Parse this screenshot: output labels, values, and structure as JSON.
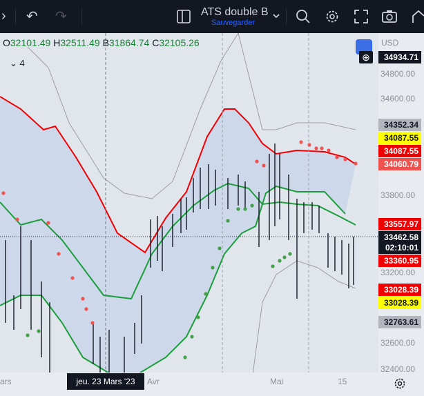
{
  "toolbar": {
    "title": "ATS double B",
    "subtitle": "Sauvegarder",
    "icons": [
      "chevron-icon",
      "undo-icon",
      "redo-icon",
      "layout-icon",
      "chevron-down-icon",
      "search-icon",
      "settings-icon",
      "fullscreen-icon",
      "camera-icon",
      "publish-icon"
    ]
  },
  "legend": {
    "open_key": "O",
    "open": "32101.49",
    "high_key": "H",
    "high": "32511.49",
    "low_key": "B",
    "low": "31864.74",
    "close_key": "C",
    "close": "32105.26",
    "indicator_count": "4"
  },
  "axis": {
    "currency": "USD",
    "ticks": [
      "34800.00",
      "34600.00",
      "33800.00",
      "33200.00",
      "32600.00",
      "32400.00"
    ]
  },
  "price_labels": [
    {
      "text": "34934.71",
      "bg": "#131722",
      "fg": "#ffffff"
    },
    {
      "text": "34352.34",
      "bg": "#b2b5be",
      "fg": "#131722"
    },
    {
      "text": "34087.55",
      "bg": "#ffff00",
      "fg": "#131722"
    },
    {
      "text": "34087.55",
      "bg": "#f00000",
      "fg": "#ffffff"
    },
    {
      "text": "34060.79",
      "bg": "#ef5350",
      "fg": "#ffffff"
    },
    {
      "text": "33557.97",
      "bg": "#f00000",
      "fg": "#ffffff"
    },
    {
      "text": "33462.58",
      "bg": "#131722",
      "fg": "#ffffff"
    },
    {
      "text": "02:10:01",
      "bg": "#131722",
      "fg": "#ffffff"
    },
    {
      "text": "33360.95",
      "bg": "#f00000",
      "fg": "#ffffff"
    },
    {
      "text": "33028.39",
      "bg": "#f00000",
      "fg": "#ffffff"
    },
    {
      "text": "33028.39",
      "bg": "#ffff00",
      "fg": "#131722"
    },
    {
      "text": "32763.61",
      "bg": "#b2b5be",
      "fg": "#131722"
    }
  ],
  "time_axis": {
    "labels": [
      "ars",
      "Avr",
      "Mai",
      "15"
    ],
    "crosshair_date": "jeu. 23 Mars '23"
  },
  "colors": {
    "bull": "#1a9e3a",
    "bear": "#f00000",
    "band_fill": "#c9d6ea",
    "outer_band": "#9e9e9e",
    "psar_green": "#43a047",
    "psar_red": "#ef5350"
  }
}
